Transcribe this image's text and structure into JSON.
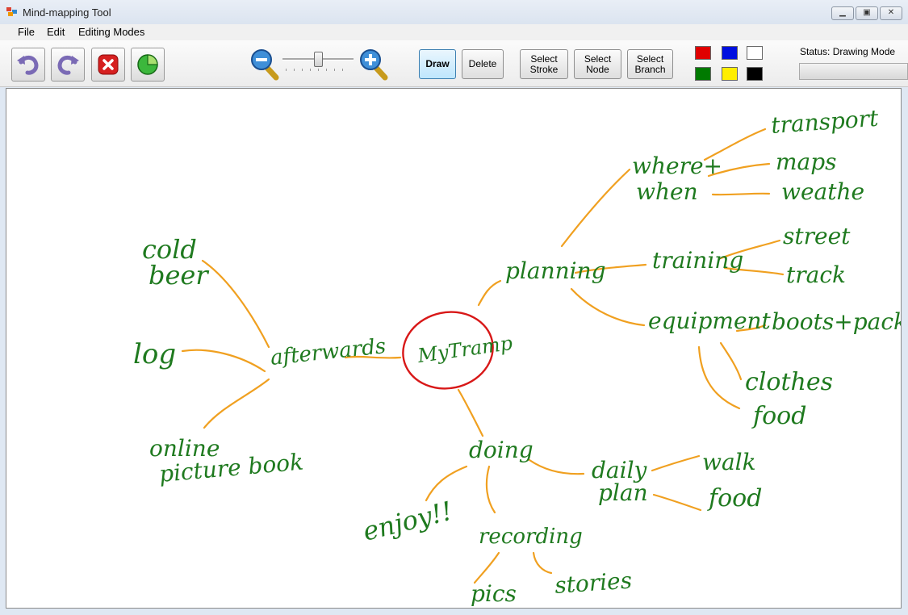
{
  "window": {
    "title": "Mind-mapping Tool"
  },
  "menu": {
    "file": "File",
    "edit": "Edit",
    "editing_modes": "Editing Modes"
  },
  "toolbar": {
    "draw": "Draw",
    "delete": "Delete",
    "select_stroke": "Select\nStroke",
    "select_node": "Select\nNode",
    "select_branch": "Select\nBranch",
    "zoom_level": 0.5,
    "colors": {
      "red": "#e00000",
      "blue": "#0010e0",
      "white": "#ffffff",
      "green": "#007a00",
      "yellow": "#ffee00",
      "black": "#000000"
    }
  },
  "status": {
    "text": "Status: Drawing Mode"
  },
  "mindmap": {
    "center": "MyTramp",
    "planning": "planning",
    "where_when_1": "where+",
    "where_when_2": "when",
    "transport": "transport",
    "maps": "maps",
    "weather": "weathe",
    "training": "training",
    "street": "street",
    "track": "track",
    "equipment": "equipment",
    "boots": "boots+pack",
    "clothes": "clothes",
    "food1": "food",
    "afterwards": "afterwards",
    "cold": "cold",
    "beer": "beer",
    "log": "log",
    "online": "online",
    "picturebook": "picture book",
    "doing": "doing",
    "daily": "daily",
    "plan": "plan",
    "walk": "walk",
    "food2": "food",
    "enjoy": "enjoy!!",
    "recording": "recording",
    "pics": "pics",
    "stories": "stories"
  }
}
